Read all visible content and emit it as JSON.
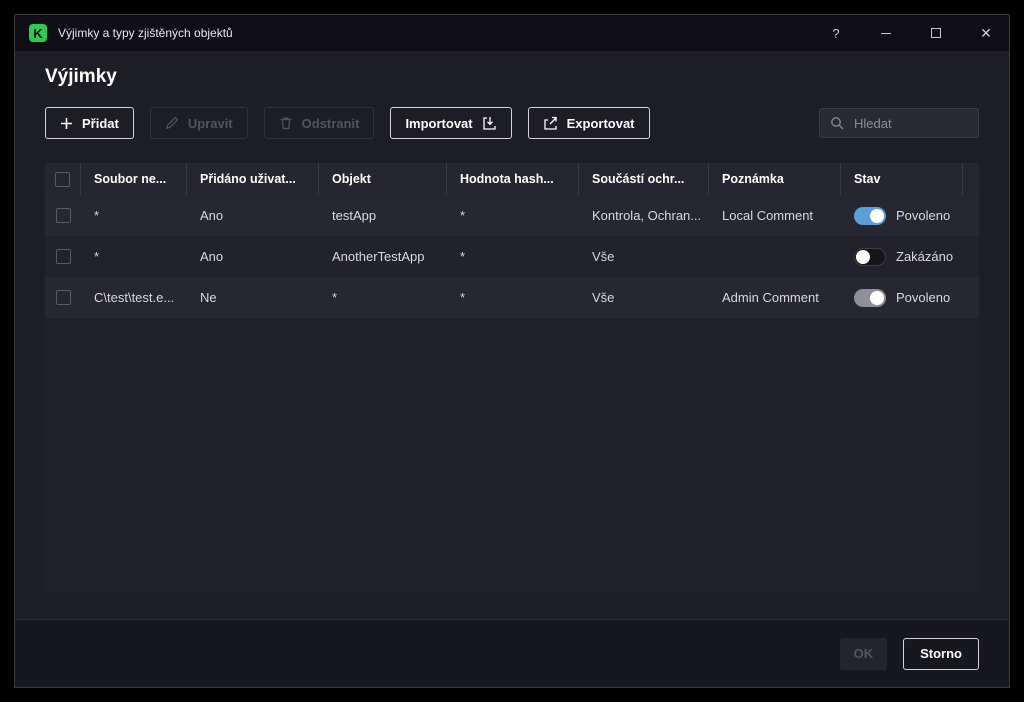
{
  "window": {
    "title": "Výjimky a typy zjištěných objektů"
  },
  "page": {
    "title": "Výjimky"
  },
  "toolbar": {
    "add": "Přidat",
    "edit": "Upravit",
    "remove": "Odstranit",
    "import": "Importovat",
    "export": "Exportovat",
    "search_placeholder": "Hledat"
  },
  "table": {
    "columns": {
      "file": "Soubor ne...",
      "added_by_user": "Přidáno uživat...",
      "object": "Objekt",
      "hash": "Hodnota hash...",
      "protection": "Součástí ochr...",
      "note": "Poznámka",
      "state": "Stav"
    },
    "rows": [
      {
        "file": "*",
        "added_by_user": "Ano",
        "object": "testApp",
        "hash": "*",
        "protection": "Kontrola, Ochran...",
        "note": "Local Comment",
        "state_label": "Povoleno",
        "toggle": "on"
      },
      {
        "file": "*",
        "added_by_user": "Ano",
        "object": "AnotherTestApp",
        "hash": "*",
        "protection": "Vše",
        "note": "",
        "state_label": "Zakázáno",
        "toggle": "off"
      },
      {
        "file": "C\\test\\test.e...",
        "added_by_user": "Ne",
        "object": "*",
        "hash": "*",
        "protection": "Vše",
        "note": "Admin Comment",
        "state_label": "Povoleno",
        "toggle": "on-gray"
      }
    ]
  },
  "footer": {
    "ok": "OK",
    "cancel": "Storno"
  },
  "colors": {
    "accent_green": "#2ecb53",
    "toggle_on_blue": "#5b9ed9",
    "toggle_on_gray": "#8f8f99"
  }
}
